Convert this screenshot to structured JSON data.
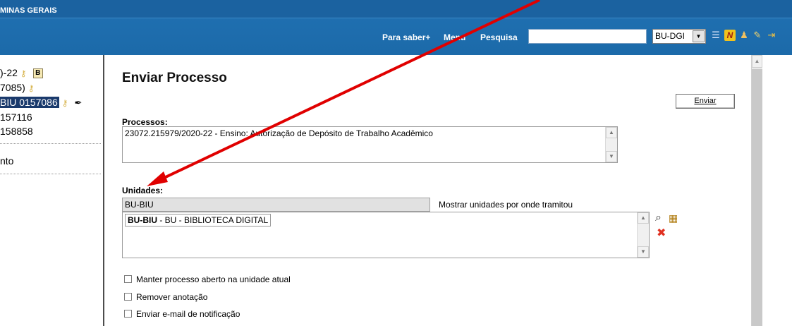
{
  "header": {
    "org_title": "MINAS GERAIS",
    "links": {
      "help": "Para saber+",
      "menu": "Menu",
      "search": "Pesquisa"
    },
    "search_value": "",
    "unit_select": "BU-DGI",
    "icons": [
      "list-icon",
      "n-notes-icon",
      "user-icon",
      "wrench-icon",
      "exit-icon"
    ]
  },
  "left_panel": {
    "tree": [
      {
        "text": ")-22",
        "icons": [
          "key-icon",
          "b-badge-icon"
        ]
      },
      {
        "text": "7085)",
        "icons": [
          "key-icon"
        ]
      },
      {
        "text": "BIU 0157086",
        "selected": true,
        "icons": [
          "key-icon",
          "pen-icon"
        ]
      },
      {
        "text": "157116"
      },
      {
        "text": "158858"
      }
    ],
    "menu_item": "nto"
  },
  "form": {
    "title": "Enviar Processo",
    "send_button": "Enviar",
    "processos_label": "Processos:",
    "processos_value": "23072.215979/2020-22 - Ensino: Autorização de Depósito de Trabalho Acadêmico",
    "unidades_label": "Unidades:",
    "unidade_input": "BU-BIU",
    "show_units_label": "Mostrar unidades por onde tramitou",
    "selected_unit_code": "BU-BIU",
    "selected_unit_name": " - BU - BIBLIOTECA DIGITAL",
    "checkboxes": [
      {
        "label": "Manter processo aberto na unidade atual",
        "checked": false
      },
      {
        "label": "Remover anotação",
        "checked": false
      },
      {
        "label": "Enviar e-mail de notificação",
        "checked": false
      }
    ]
  },
  "colors": {
    "header_blue": "#1c6aa9",
    "selection_navy": "#1a3a6c",
    "annotation_red": "#e00000"
  }
}
